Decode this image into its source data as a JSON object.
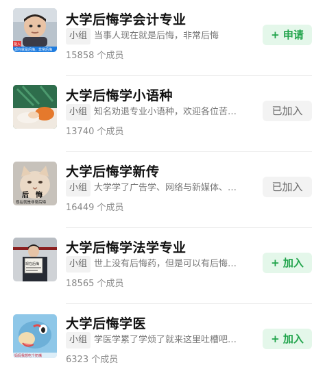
{
  "groups": [
    {
      "title": "大学后悔学会计专业",
      "tag": "小组",
      "desc": "当事人现在就是后悔，非常后悔",
      "members": "15858 个成员",
      "button": "+ 申请",
      "button_state": "apply",
      "thumb_caption": "现在就是后悔，非常后悔",
      "thumb_badge": "能入"
    },
    {
      "title": "大学后悔学小语种",
      "tag": "小组",
      "desc": "知名劝退专业小语种，欢迎各位苦…",
      "members": "13740 个成员",
      "button": "已加入",
      "button_state": "joined"
    },
    {
      "title": "大学后悔学新传",
      "tag": "小组",
      "desc": "大学学了广告学、网络与新媒体、…",
      "members": "16449 个成员",
      "button": "已加入",
      "button_state": "joined",
      "thumb_caption": "现在就是非常后悔",
      "thumb_big": "后　悔"
    },
    {
      "title": "大学后悔学法学专业",
      "tag": "小组",
      "desc": "世上没有后悔药，但是可以有后悔…",
      "members": "18565 个成员",
      "button": "+ 加入",
      "button_state": "apply",
      "thumb_sign": "现在后悔"
    },
    {
      "title": "大学后悔学医",
      "tag": "小组",
      "desc": "学医学累了学烦了就来这里吐槽吧…",
      "members": "6323 个成员",
      "button": "+ 加入",
      "button_state": "apply",
      "thumb_caption": "妈妈我想吃个奶嘴"
    }
  ],
  "colors": {
    "accent_green": "#1fa34a",
    "accent_green_bg": "#e4f7ea",
    "joined_bg": "#f3f3f3"
  }
}
